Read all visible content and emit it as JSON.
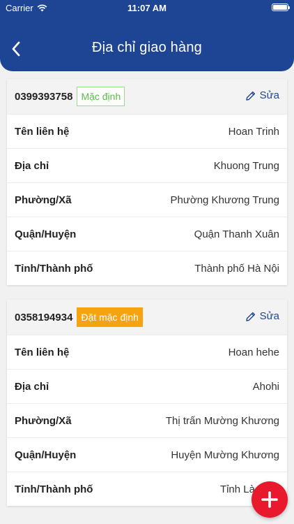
{
  "status_bar": {
    "carrier": "Carrier",
    "time": "11:07 AM"
  },
  "header": {
    "title": "Địa chỉ giao hàng"
  },
  "addresses": [
    {
      "phone": "0399393758",
      "badge": "Mặc định",
      "edit_label": "Sửa",
      "rows": [
        {
          "label": "Tên liên hệ",
          "value": "Hoan Trinh"
        },
        {
          "label": "Địa chỉ",
          "value": "Khuong Trung"
        },
        {
          "label": "Phường/Xã",
          "value": "Phường Khương Trung"
        },
        {
          "label": "Quận/Huyện",
          "value": "Quận Thanh Xuân"
        },
        {
          "label": "Tỉnh/Thành phố",
          "value": "Thành phố Hà Nội"
        }
      ]
    },
    {
      "phone": "0358194934",
      "badge": "Đặt mặc định",
      "edit_label": "Sửa",
      "rows": [
        {
          "label": "Tên liên hệ",
          "value": "Hoan hehe"
        },
        {
          "label": "Địa chỉ",
          "value": "Ahohi"
        },
        {
          "label": "Phường/Xã",
          "value": "Thị trấn Mường Khương"
        },
        {
          "label": "Quận/Huyện",
          "value": "Huyện Mường Khương"
        },
        {
          "label": "Tỉnh/Thành phố",
          "value": "Tỉnh Lào Cai"
        }
      ]
    }
  ],
  "colors": {
    "primary": "#1e4593",
    "default_badge": "#5cba4b",
    "set_default_badge": "#f5a30f",
    "fab": "#e8192c"
  },
  "icons": {
    "back": "chevron-left-icon",
    "edit": "pencil-icon",
    "add": "plus-icon",
    "wifi": "wifi-icon",
    "battery": "battery-icon"
  }
}
